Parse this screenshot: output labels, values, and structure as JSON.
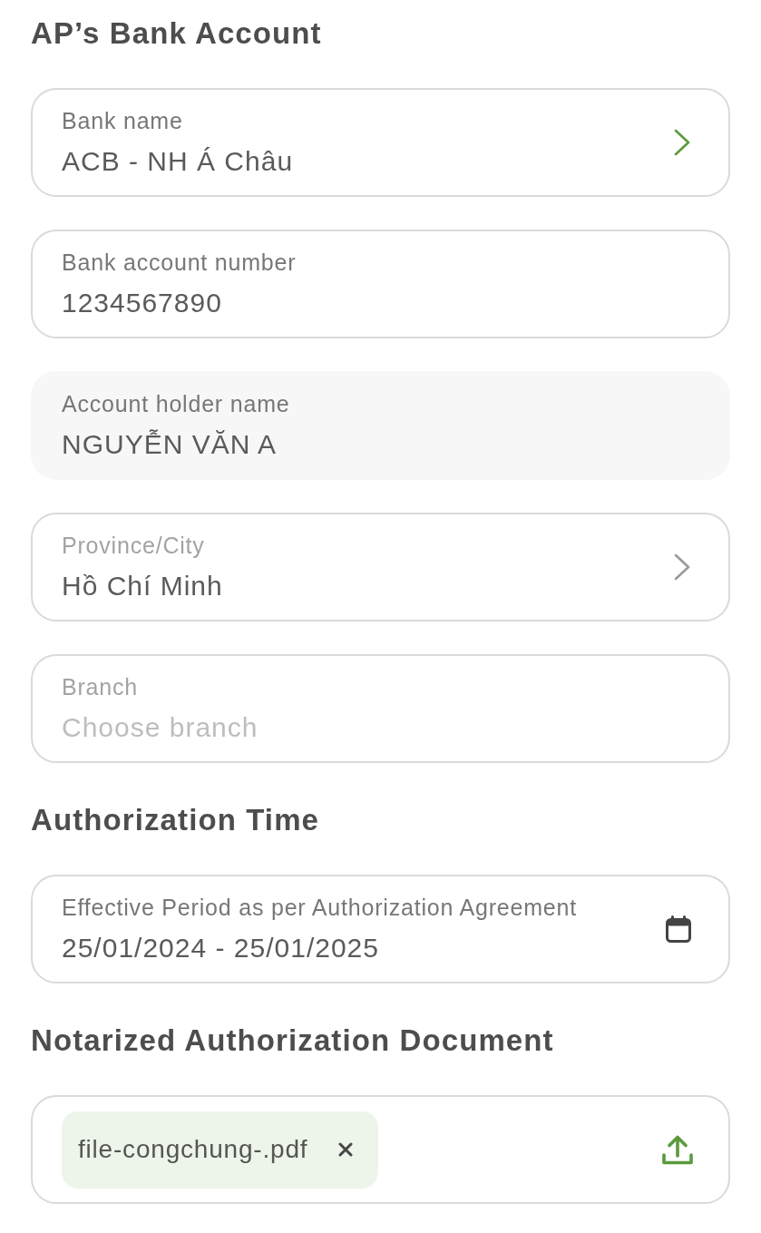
{
  "sections": [
    {
      "title": "AP’s Bank Account",
      "fields": [
        {
          "kind": "select",
          "label": "Bank name",
          "value": "ACB - NH Á Châu",
          "disabled": false,
          "label_muted": false,
          "trailing": {
            "accent": true
          }
        },
        {
          "kind": "text",
          "label": "Bank account number",
          "value": "1234567890",
          "disabled": false,
          "label_muted": false
        },
        {
          "kind": "text",
          "label": "Account holder name",
          "value": "NGUYỄN VĂN A",
          "disabled": true,
          "label_muted": false
        },
        {
          "kind": "select",
          "label": "Province/City",
          "value": "Hồ Chí Minh",
          "disabled": false,
          "label_muted": true,
          "trailing": {
            "accent": false
          }
        },
        {
          "kind": "text",
          "label": "Branch",
          "placeholder": "Choose branch",
          "disabled": false,
          "label_muted": true
        }
      ]
    },
    {
      "title": "Authorization Time",
      "fields": [
        {
          "kind": "date",
          "label": "Effective Period as per Authorization Agreement",
          "value": "25/01/2024 - 25/01/2025",
          "disabled": false,
          "label_muted": false
        }
      ]
    },
    {
      "title": "Notarized Authorization Document",
      "fields": [
        {
          "kind": "upload",
          "files": [
            {
              "name": "file-congchung-.pdf"
            }
          ]
        }
      ]
    }
  ]
}
